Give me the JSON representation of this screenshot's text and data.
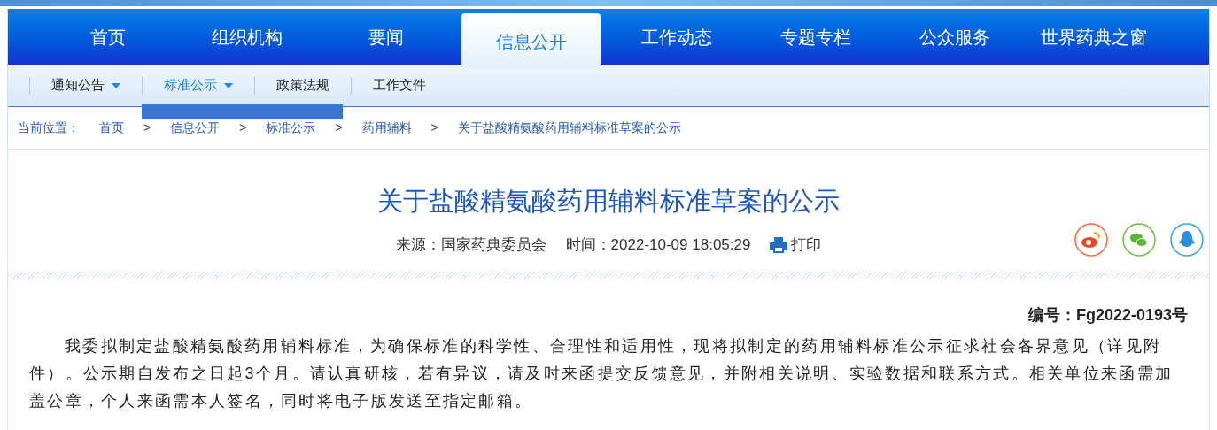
{
  "nav": [
    {
      "label": "首页",
      "selected": false
    },
    {
      "label": "组织机构",
      "selected": false
    },
    {
      "label": "要闻",
      "selected": false
    },
    {
      "label": "信息公开",
      "selected": true
    },
    {
      "label": "工作动态",
      "selected": false
    },
    {
      "label": "专题专栏",
      "selected": false
    },
    {
      "label": "公众服务",
      "selected": false
    },
    {
      "label": "世界药典之窗",
      "selected": false
    }
  ],
  "subnav": [
    {
      "label": "通知公告",
      "selected": false,
      "has_menu": true
    },
    {
      "label": "标准公示",
      "selected": true,
      "has_menu": true
    },
    {
      "label": "政策法规",
      "selected": false,
      "has_menu": false
    },
    {
      "label": "工作文件",
      "selected": false,
      "has_menu": false
    }
  ],
  "breadcrumb": {
    "label": "当前位置：",
    "items": [
      "首页",
      "信息公开",
      "标准公示",
      "药用辅料",
      "关于盐酸精氨酸药用辅料标准草案的公示"
    ],
    "separator": ">"
  },
  "article": {
    "title": "关于盐酸精氨酸药用辅料标准草案的公示",
    "source": "来源：国家药典委员会",
    "time": "时间：2022-10-09 18:05:29",
    "print": "打印",
    "number": "编号：Fg2022-0193号",
    "body": "我委拟制定盐酸精氨酸药用辅料标准，为确保标准的科学性、合理性和适用性，现将拟制定的药用辅料标准公示征求社会各界意见（详见附件）。公示期自发布之日起3个月。请认真研核，若有异议，请及时来函提交反馈意见，并附相关说明、实验数据和联系方式。相关单位来函需加盖公章，个人来函需本人签名，同时将电子版发送至指定邮箱。"
  }
}
